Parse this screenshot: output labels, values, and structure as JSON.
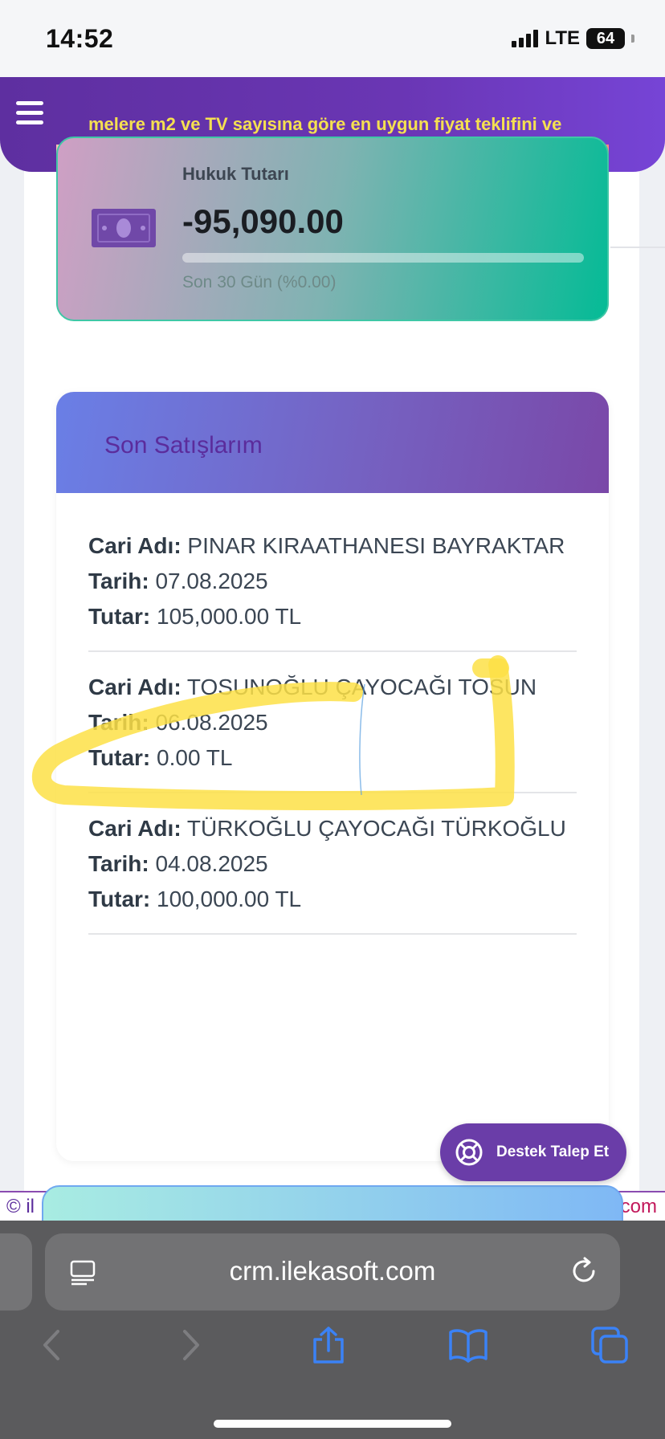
{
  "status_bar": {
    "time": "14:52",
    "network": "LTE",
    "battery": "64"
  },
  "header": {
    "marquee_text": "melere m2 ve TV sayısına göre en uygun fiyat teklifini ve"
  },
  "stat_card": {
    "label": "Hukuk Tutarı",
    "value": "-95,090.00",
    "subtitle": "Son 30 Gün (%0.00)",
    "progress_percent": 0
  },
  "sales": {
    "title": "Son Satışlarım",
    "field_labels": {
      "name": "Cari Adı:",
      "date": "Tarih:",
      "amount": "Tutar:"
    },
    "items": [
      {
        "name": "PINAR KIRAATHANESI BAYRAKTAR",
        "date": "07.08.2025",
        "amount": "105,000.00 TL"
      },
      {
        "name": "TOSUNOĞLU ÇAYOCAĞI TOSUN",
        "date": "06.08.2025",
        "amount": "0.00 TL"
      },
      {
        "name": "TÜRKOĞLU ÇAYOCAĞI TÜRKOĞLU",
        "date": "04.08.2025",
        "amount": "100,000.00 TL"
      }
    ]
  },
  "support_button": {
    "label": "Destek Talep Et"
  },
  "footer": {
    "left_text": "© il",
    "right_text": "com"
  },
  "browser": {
    "url": "crm.ilekasoft.com"
  },
  "colors": {
    "header_purple": "#6a36b4",
    "marquee_yellow": "#f5e050",
    "sales_title": "#5b2c9c",
    "annotation_yellow": "#fde047"
  }
}
